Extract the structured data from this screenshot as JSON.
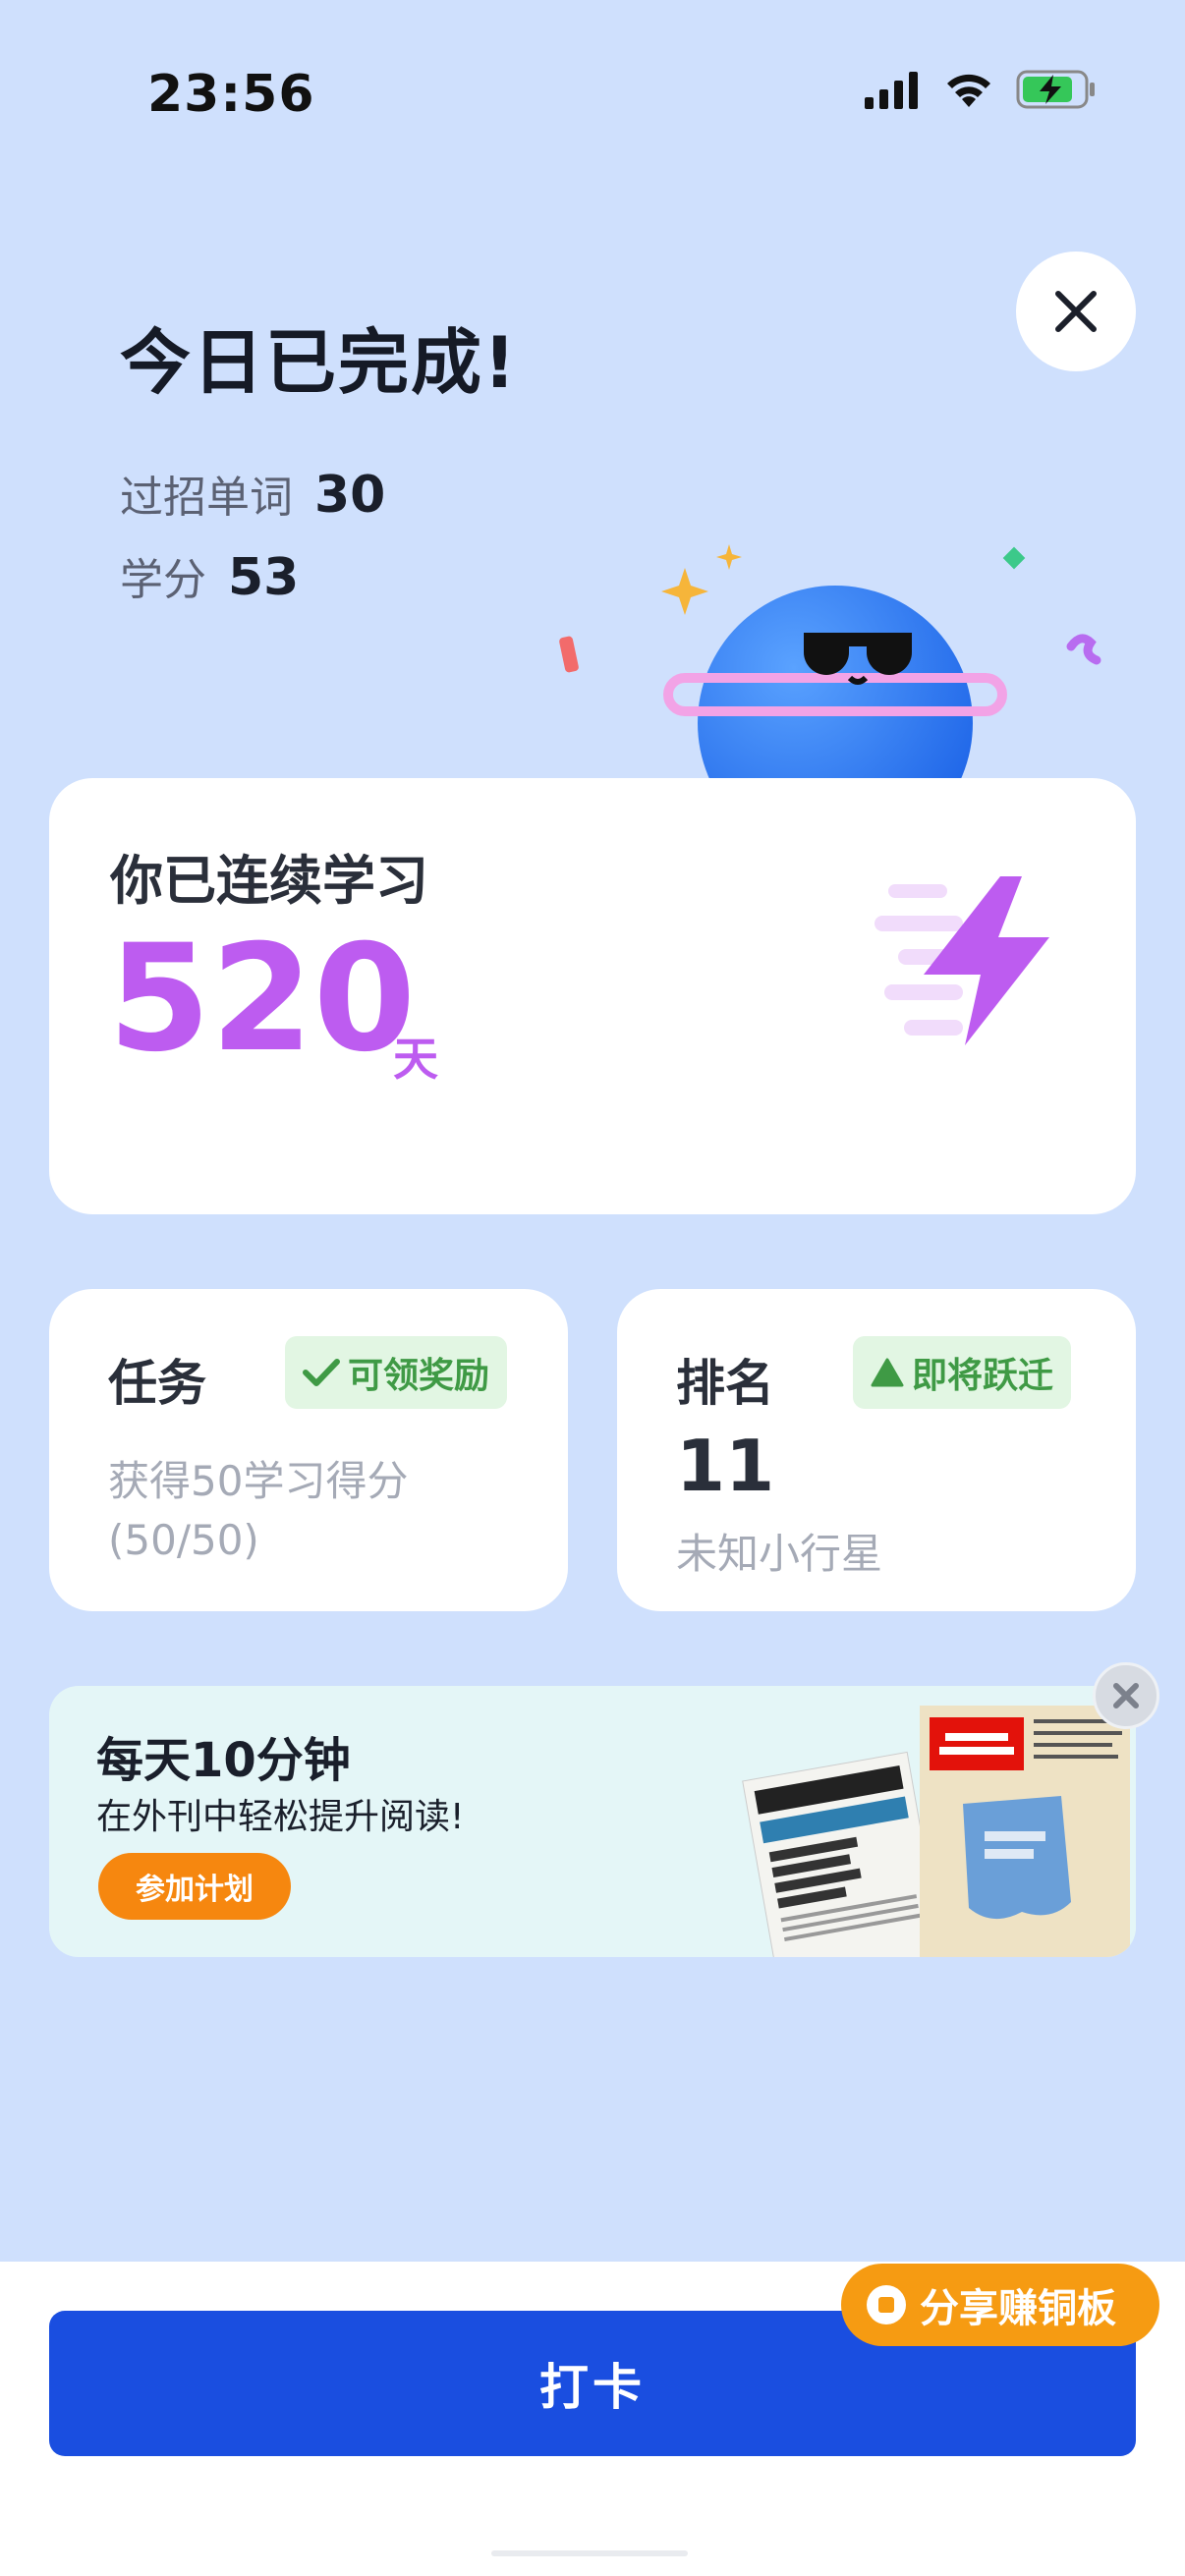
{
  "status_bar": {
    "time": "23:56"
  },
  "header": {
    "title": "今日已完成!",
    "stats": [
      {
        "label": "过招单词",
        "value": "30"
      },
      {
        "label": "学分",
        "value": "53"
      }
    ]
  },
  "streak": {
    "label": "你已连续学习",
    "days": "520",
    "unit": "天"
  },
  "task_card": {
    "title": "任务",
    "badge": "可领奖励",
    "desc_line1": "获得50学习得分",
    "desc_line2": "(50/50)"
  },
  "rank_card": {
    "title": "排名",
    "badge": "即将跃迁",
    "rank": "11",
    "sub": "未知小行星"
  },
  "banner": {
    "title": "每天10分钟",
    "subtitle": "在外刊中轻松提升阅读!",
    "button": "参加计划"
  },
  "footer": {
    "checkin_label": "打卡",
    "share_label": "分享赚铜板"
  },
  "colors": {
    "accent_blue": "#1a4ee0",
    "streak_purple": "#bd5cf0",
    "share_orange": "#f69b12",
    "background": "#cfe0fd"
  }
}
